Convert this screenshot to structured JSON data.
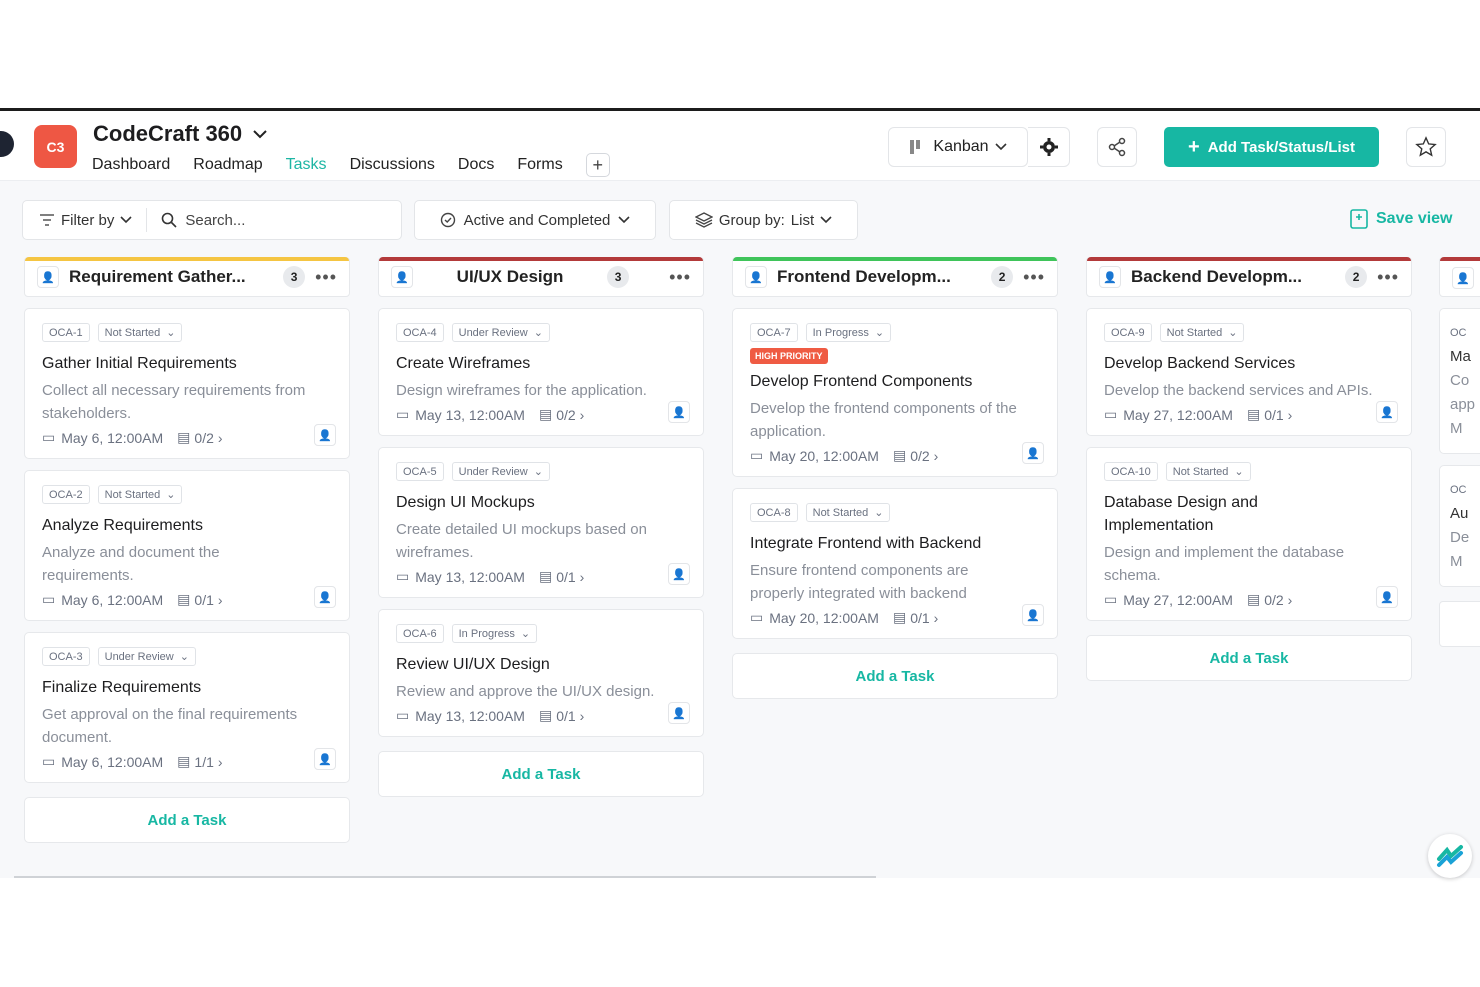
{
  "header": {
    "logo_text": "C3",
    "project_name": "CodeCraft 360",
    "nav": [
      "Dashboard",
      "Roadmap",
      "Tasks",
      "Discussions",
      "Docs",
      "Forms"
    ],
    "active_tab": "Tasks",
    "view_label": "Kanban",
    "add_button": "Add Task/Status/List"
  },
  "filters": {
    "filter_by": "Filter by",
    "search_placeholder": "Search...",
    "status_filter": "Active and Completed",
    "group_by_label": "Group by:",
    "group_by_value": "List",
    "save_view": "Save view"
  },
  "colors": {
    "accent": "#17b7a3",
    "logo": "#ee5744",
    "priority": "#ef5b43"
  },
  "add_task_label": "Add a Task",
  "columns": [
    {
      "name": "Requirement Gather...",
      "count": "3",
      "color": "#f5c542",
      "cards": [
        {
          "id": "OCA-1",
          "status": "Not Started",
          "title": "Gather Initial Requirements",
          "desc": "Collect all necessary requirements from stakeholders.",
          "date": "May 6, 12:00AM",
          "sub": "0/2"
        },
        {
          "id": "OCA-2",
          "status": "Not Started",
          "title": "Analyze Requirements",
          "desc": "Analyze and document the requirements.",
          "date": "May 6, 12:00AM",
          "sub": "0/1"
        },
        {
          "id": "OCA-3",
          "status": "Under Review",
          "title": "Finalize Requirements",
          "desc": "Get approval on the final requirements document.",
          "date": "May 6, 12:00AM",
          "sub": "1/1"
        }
      ]
    },
    {
      "name": "UI/UX Design",
      "count": "3",
      "color": "#b33a3a",
      "cards": [
        {
          "id": "OCA-4",
          "status": "Under Review",
          "title": "Create Wireframes",
          "desc": "Design wireframes for the application.",
          "date": "May 13, 12:00AM",
          "sub": "0/2"
        },
        {
          "id": "OCA-5",
          "status": "Under Review",
          "title": "Design UI Mockups",
          "desc": "Create detailed UI mockups based on wireframes.",
          "date": "May 13, 12:00AM",
          "sub": "0/1"
        },
        {
          "id": "OCA-6",
          "status": "In Progress",
          "title": "Review UI/UX Design",
          "desc": "Review and approve the UI/UX design.",
          "date": "May 13, 12:00AM",
          "sub": "0/1"
        }
      ]
    },
    {
      "name": "Frontend Developm...",
      "count": "2",
      "color": "#3fc45a",
      "cards": [
        {
          "id": "OCA-7",
          "status": "In Progress",
          "priority": "HIGH PRIORITY",
          "title": "Develop Frontend Components",
          "desc": "Develop the frontend components of the application.",
          "date": "May 20, 12:00AM",
          "sub": "0/2"
        },
        {
          "id": "OCA-8",
          "status": "Not Started",
          "title": "Integrate Frontend with Backend",
          "desc": "Ensure frontend components are properly integrated with backend",
          "date": "May 20, 12:00AM",
          "sub": "0/1"
        }
      ]
    },
    {
      "name": "Backend Developm...",
      "count": "2",
      "color": "#b33a3a",
      "cards": [
        {
          "id": "OCA-9",
          "status": "Not Started",
          "title": "Develop Backend Services",
          "desc": "Develop the backend services and APIs.",
          "date": "May 27, 12:00AM",
          "sub": "0/1"
        },
        {
          "id": "OCA-10",
          "status": "Not Started",
          "title": "Database Design and Implementation",
          "desc": "Design and implement the database schema.",
          "date": "May 27, 12:00AM",
          "sub": "0/2"
        }
      ]
    }
  ],
  "partial_column": {
    "cards": [
      {
        "id": "OC",
        "title": "Ma",
        "desc": [
          "Co",
          "app"
        ],
        "date": "M"
      },
      {
        "id": "OC",
        "title": "Au",
        "desc": [
          "De"
        ],
        "date": "M"
      }
    ]
  }
}
